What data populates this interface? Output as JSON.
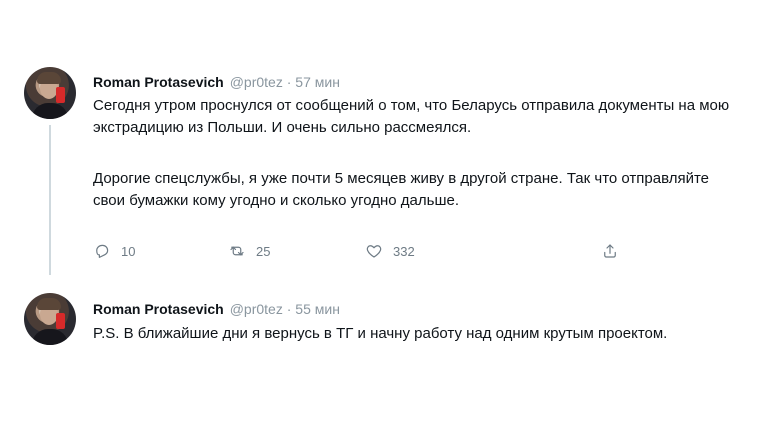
{
  "tweets": [
    {
      "author_name": "Roman Protasevich",
      "meta": "@pr0tez · 57 мин",
      "paragraphs": [
        "Сегодня утром проснулся от сообщений о том, что Беларусь отправила документы на мою экстрадицию из Польши. И очень сильно рассмеялся.",
        "Дорогие спецслужбы, я уже почти 5 месяцев живу в другой стране. Так что отправляйте свои бумажки кому угодно и сколько угодно дальше."
      ],
      "actions": {
        "reply_count": "10",
        "retweet_count": "25",
        "like_count": "332"
      }
    },
    {
      "author_name": "Roman Protasevich",
      "meta": "@pr0tez · 55 мин",
      "paragraphs": [
        "P.S. В ближайшие дни я вернусь в ТГ и начну работу над одним крутым проектом."
      ]
    }
  ],
  "icons": {
    "reply": "reply-icon",
    "retweet": "retweet-icon",
    "like": "heart-icon",
    "share": "share-icon"
  }
}
